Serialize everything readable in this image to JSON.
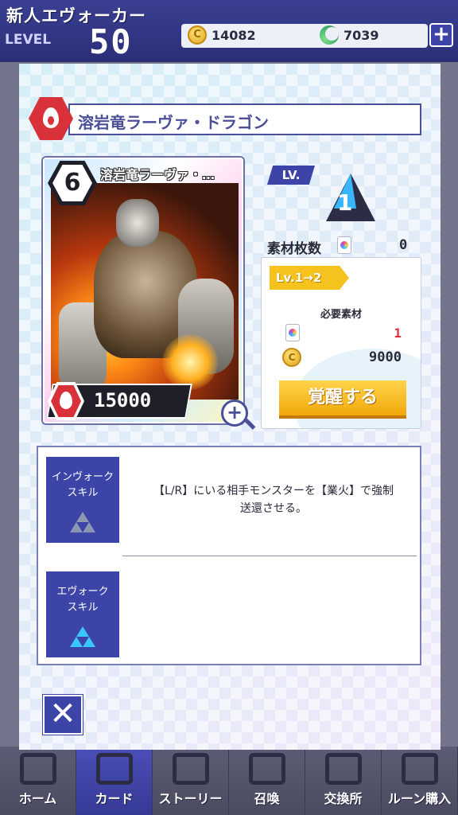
{
  "header": {
    "rank_title": "新人エヴォーカー",
    "level_label": "LEVEL",
    "level_value": "50",
    "coin_symbol": "C",
    "coins": "14082",
    "gems": "7039",
    "add_label": "+"
  },
  "nav": {
    "items": [
      {
        "label": "ホーム",
        "icon": "home-icon"
      },
      {
        "label": "カード",
        "icon": "card-icon",
        "active": true
      },
      {
        "label": "ストーリー",
        "icon": "story-icon"
      },
      {
        "label": "召喚",
        "icon": "summon-icon"
      },
      {
        "label": "交換所",
        "icon": "exchange-icon"
      },
      {
        "label": "ルーン購入",
        "icon": "rune-icon"
      }
    ]
  },
  "modal": {
    "title": "溶岩竜ラーヴァ・ドラゴン",
    "attribute": "fire",
    "card": {
      "cost": "6",
      "name": "溶岩竜ラーヴァ・…",
      "power": "15000",
      "zoom_label": "+"
    },
    "level": {
      "badge": "LV.",
      "value": "1"
    },
    "material": {
      "label": "素材枚数",
      "count": "0"
    },
    "upgrade": {
      "step": "Lv.1→2",
      "required_label": "必要素材",
      "material_required": "1",
      "coin_symbol": "C",
      "coin_required": "9000",
      "button": "覚醒する"
    },
    "skills": {
      "invoke_label_1": "インヴォーク",
      "invoke_label_2": "スキル",
      "invoke_desc_1": "【L/R】にいる相手モンスターを【業火】で強制",
      "invoke_desc_2": "送還させる。",
      "evoke_label_1": "エヴォーク",
      "evoke_label_2": "スキル"
    },
    "close_label": "✕"
  },
  "colors": {
    "accent": "#3d44a8",
    "fire": "#d9313a",
    "gold": "#f6c21e"
  }
}
